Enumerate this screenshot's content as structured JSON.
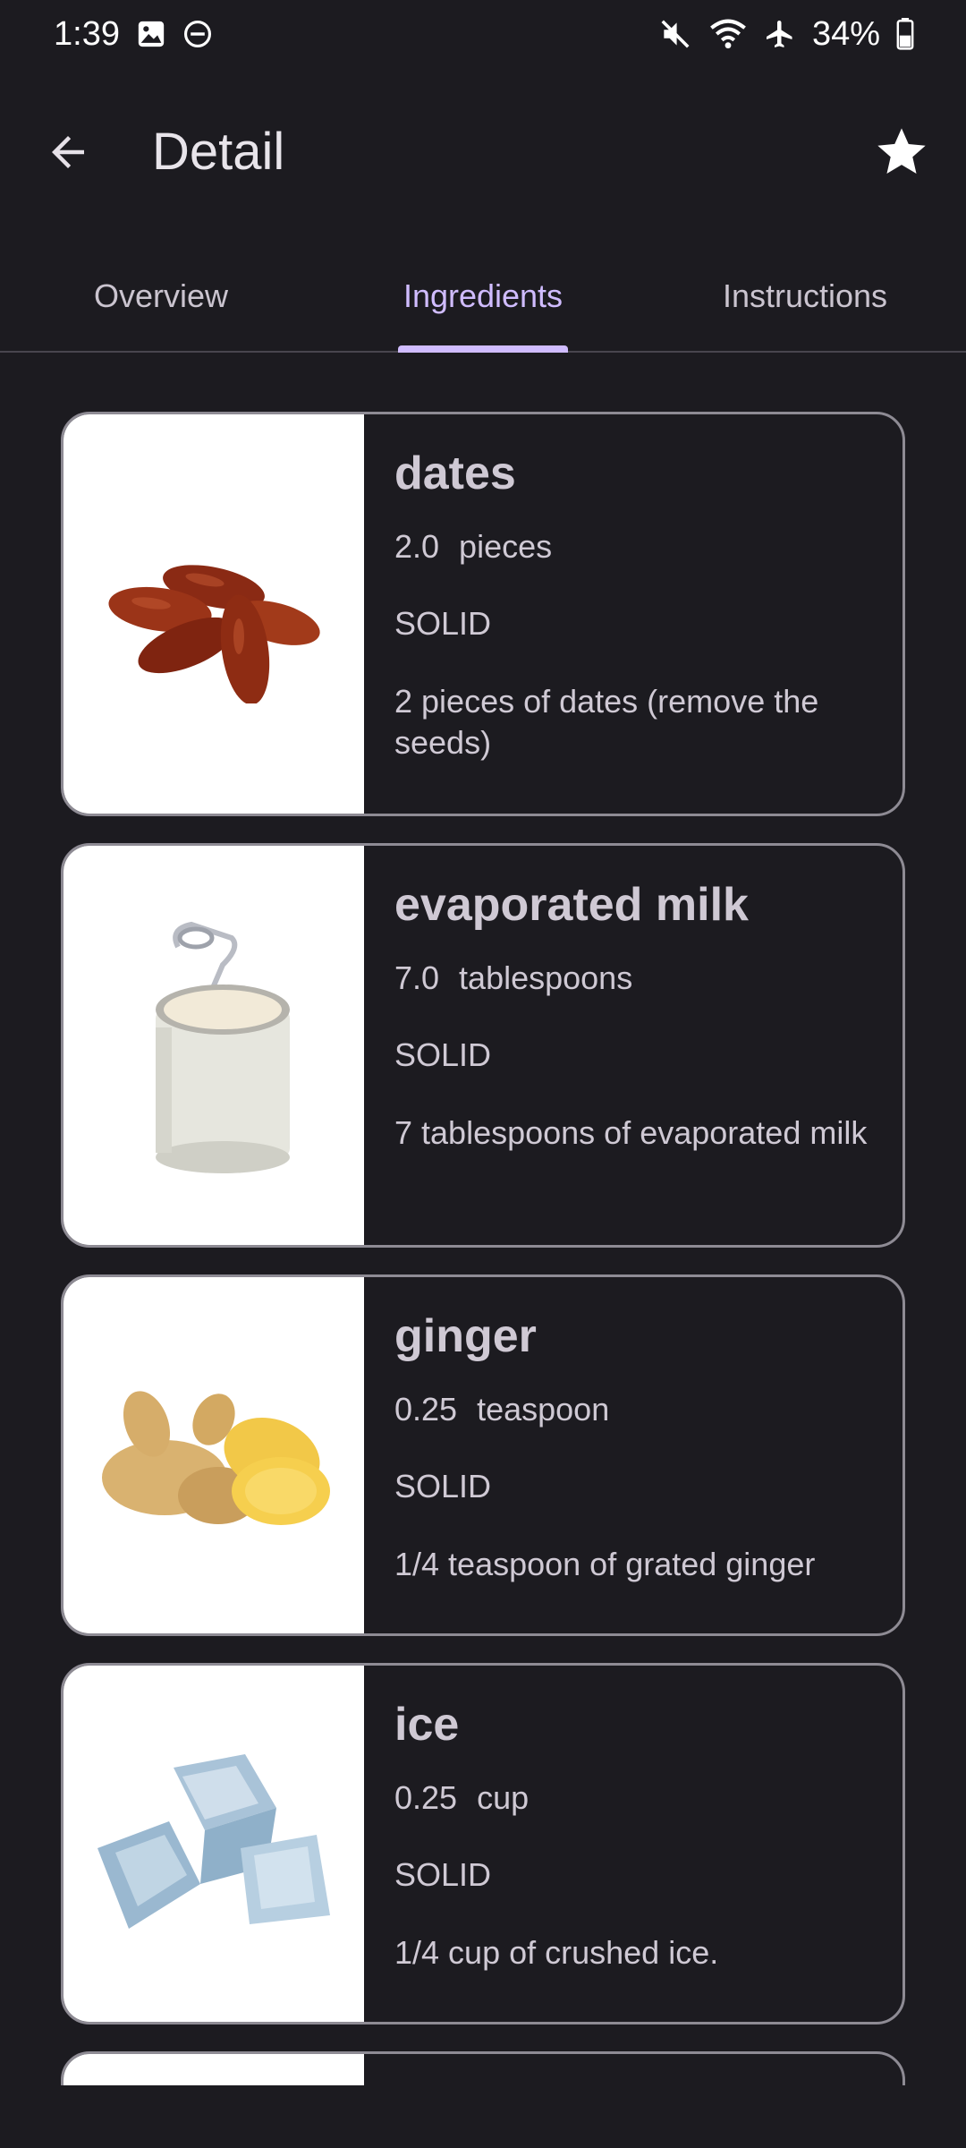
{
  "status_bar": {
    "time": "1:39",
    "battery": "34%"
  },
  "app_bar": {
    "title": "Detail"
  },
  "tabs": [
    {
      "label": "Overview",
      "active": false
    },
    {
      "label": "Ingredients",
      "active": true
    },
    {
      "label": "Instructions",
      "active": false
    }
  ],
  "colors": {
    "background": "#1c1b20",
    "accent": "#d0bcff",
    "card_border": "#8e8b94",
    "text": "#cfc9d4"
  },
  "ingredients": [
    {
      "name": "dates",
      "amount": "2.0",
      "unit": "pieces",
      "type": "SOLID",
      "description": "2 pieces of dates (remove the seeds)",
      "icon": "dates-image"
    },
    {
      "name": "evaporated milk",
      "amount": "7.0",
      "unit": "tablespoons",
      "type": "SOLID",
      "description": "7 tablespoons of evaporated milk",
      "icon": "milk-can-image"
    },
    {
      "name": "ginger",
      "amount": "0.25",
      "unit": "teaspoon",
      "type": "SOLID",
      "description": "1/4 teaspoon of grated ginger",
      "icon": "ginger-image"
    },
    {
      "name": "ice",
      "amount": "0.25",
      "unit": "cup",
      "type": "SOLID",
      "description": "1/4 cup of crushed ice.",
      "icon": "ice-image"
    }
  ]
}
